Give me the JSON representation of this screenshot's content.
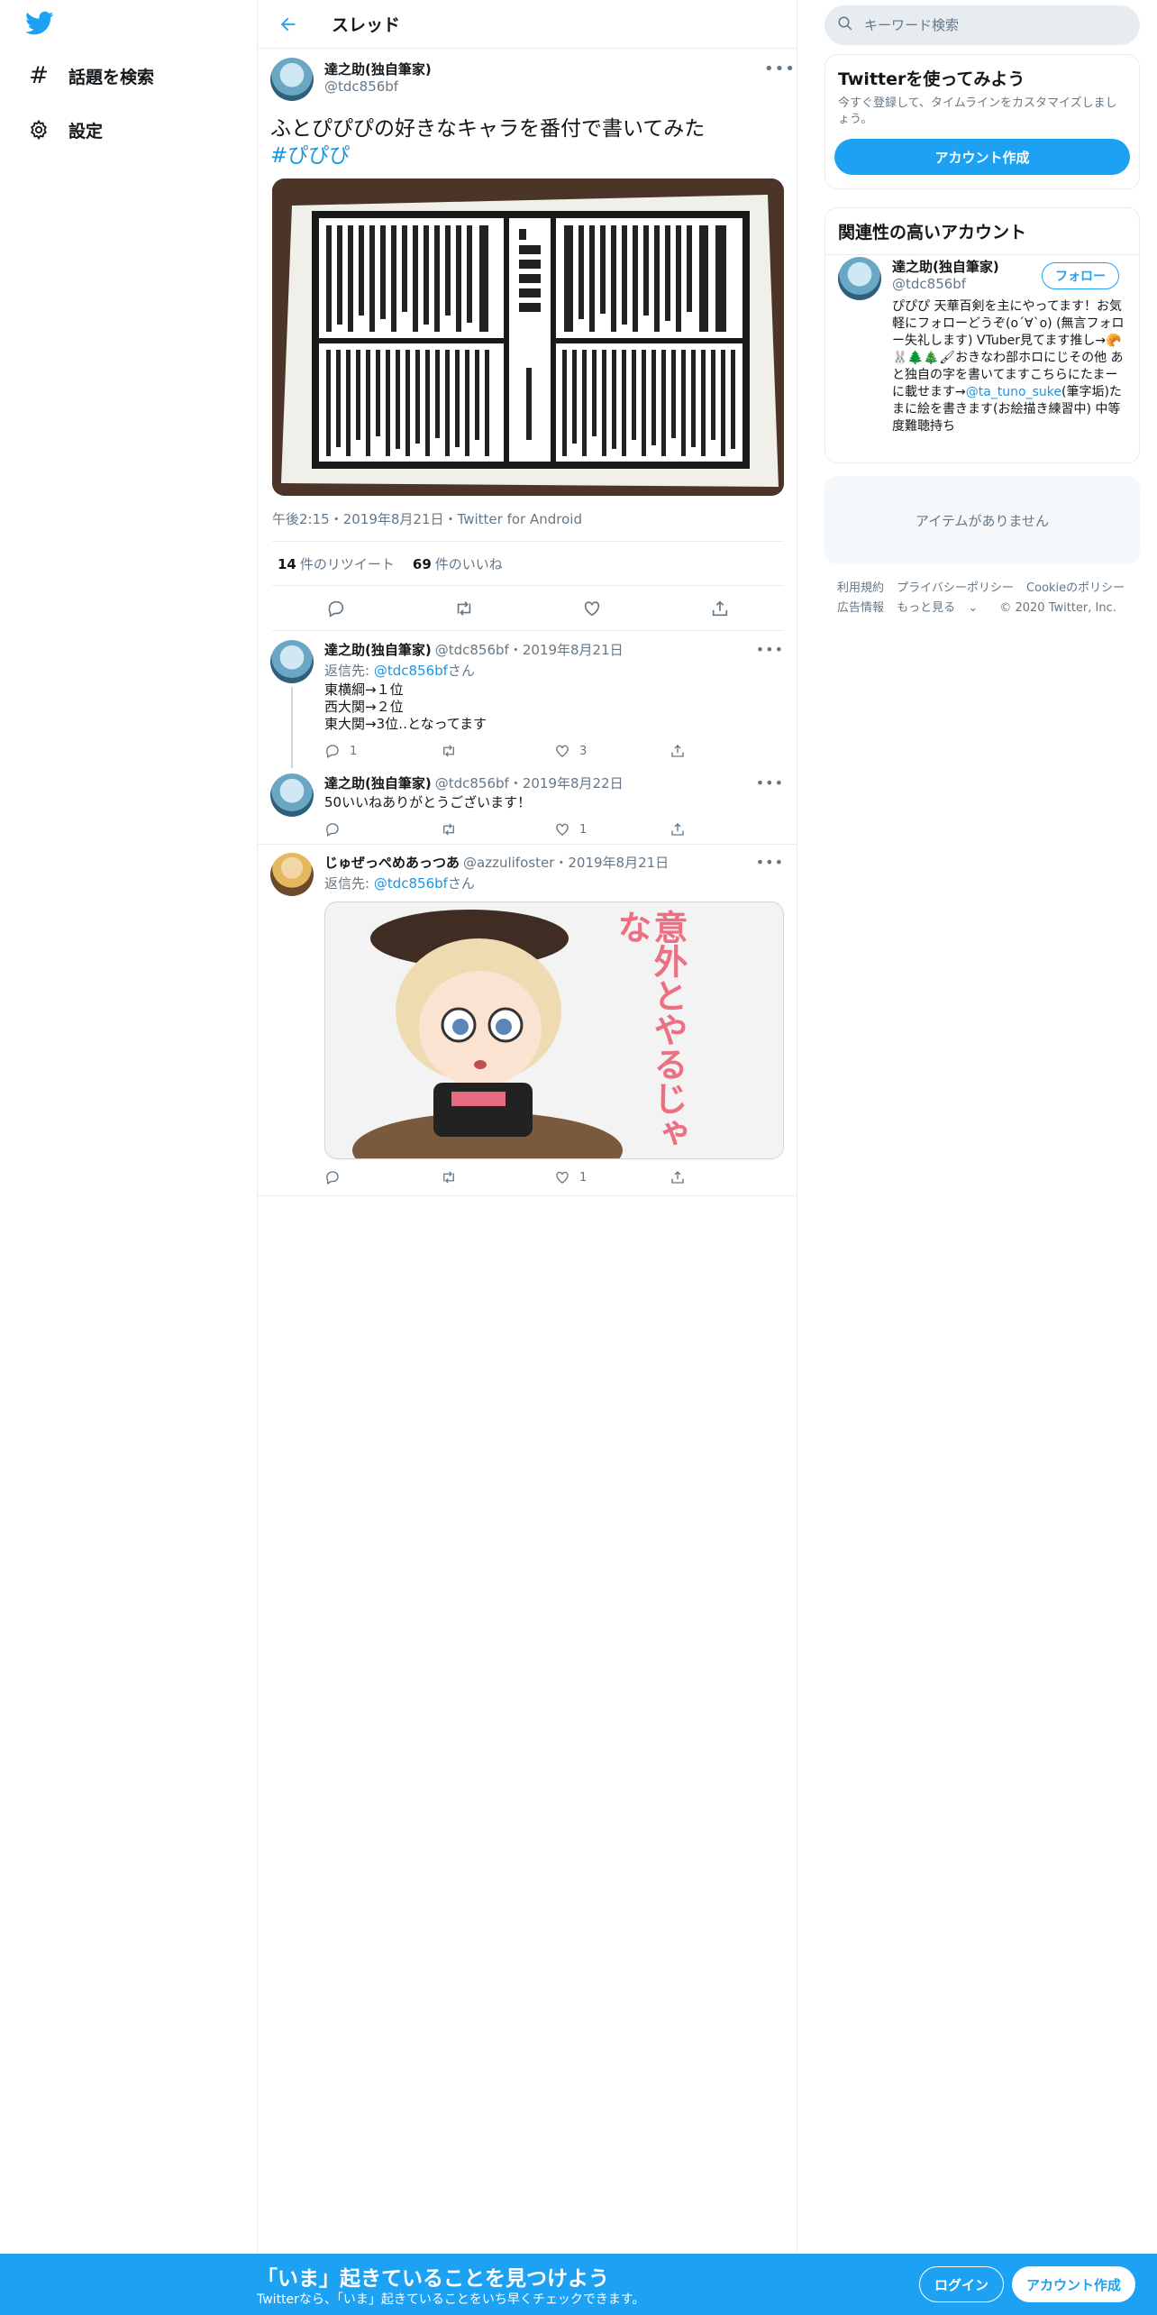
{
  "nav": {
    "items": [
      {
        "label": "話題を検索"
      },
      {
        "label": "設定"
      }
    ]
  },
  "header": {
    "title": "スレッド"
  },
  "main_tweet": {
    "author_name": "達之助(独自筆家)",
    "author_handle": "@tdc856bf",
    "text": "ふとぴぴぴの好きなキャラを番付で書いてみた",
    "hashtag": "#ぴぴぴ",
    "time": "午後2:15",
    "date": "2019年8月21日",
    "source": "Twitter for Android",
    "separator": "・",
    "retweets": "14",
    "retweets_label": "件のリツイート",
    "likes": "69",
    "likes_label": "件のいいね",
    "more": "•••"
  },
  "replies": [
    {
      "author_name": "達之助(独自筆家)",
      "author_handle": "@tdc856bf",
      "date": "2019年8月21日",
      "reply_to_prefix": "返信先: ",
      "reply_to_handle": "@tdc856bf",
      "reply_to_suffix": "さん",
      "lines": [
        "東横綱→１位",
        "西大関→２位",
        "東大関→3位‥となってます"
      ],
      "reply_count": "1",
      "retweet_count": "",
      "like_count": "3"
    },
    {
      "author_name": "達之助(独自筆家)",
      "author_handle": "@tdc856bf",
      "date": "2019年8月22日",
      "lines": [
        "50いいねありがとうございます！"
      ],
      "reply_count": "",
      "retweet_count": "",
      "like_count": "1"
    },
    {
      "author_name": "じゅぜっぺめあっつあ",
      "author_handle": "@azzulifoster",
      "date": "2019年8月21日",
      "reply_to_prefix": "返信先: ",
      "reply_to_handle": "@tdc856bf",
      "reply_to_suffix": "さん",
      "image_text": "意外とやるじゃな",
      "reply_count": "",
      "retweet_count": "",
      "like_count": "1"
    }
  ],
  "right": {
    "search_placeholder": "キーワード検索",
    "signup_panel": {
      "title": "Twitterを使ってみよう",
      "subtitle": "今すぐ登録して、タイムラインをカスタマイズしましょう。",
      "button": "アカウント作成"
    },
    "related_panel": {
      "title": "関連性の高いアカウント",
      "name": "達之助(独自筆家)",
      "handle": "@tdc856bf",
      "follow_label": "フォロー",
      "bio_1": "ぴぴぴ 天華百剣を主にやってます！お気軽にフォローどうぞ(o´∀`o) (無言フォロー失礼します) VTuber見てます推し→🥐🐰🌲🎄🖌おきなわ部ホロにじその他 あと独自の字を書いてますこちらにたまーに載せます→",
      "bio_link": "@ta_tuno_suke",
      "bio_2": "(筆字垢)たまに絵を書きます(お絵描き練習中) 中等度難聴持ち"
    },
    "empty_panel": "アイテムがありません",
    "footer": [
      "利用規約",
      "プライバシーポリシー",
      "Cookieのポリシー",
      "広告情報",
      "もっと見る",
      "© 2020 Twitter, Inc."
    ]
  },
  "bottom_bar": {
    "title": "「いま」起きていることを見つけよう",
    "subtitle": "Twitterなら、「いま」起きていることをいち早くチェックできます。",
    "login": "ログイン",
    "signup": "アカウント作成"
  },
  "colors": {
    "accent": "#1da1f2",
    "link": "#1b95e0",
    "muted": "#657786",
    "border": "#e6ecf0"
  }
}
